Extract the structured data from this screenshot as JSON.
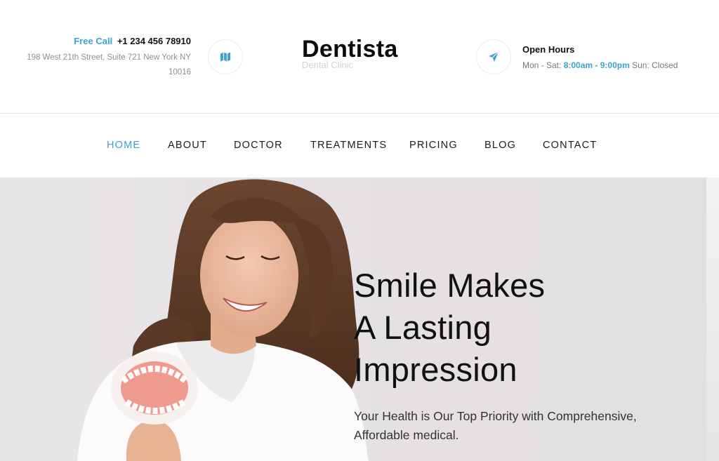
{
  "header": {
    "call_label": "Free Call",
    "phone": "+1 234 456 78910",
    "address_line1": "198 West 21th Street, Suite 721 New York NY",
    "address_line2": "10016",
    "logo_title": "Dentista",
    "logo_subtitle": "Dental Clinic",
    "hours_title": "Open Hours",
    "hours_prefix": "Mon - Sat:",
    "hours_time": "8:00am - 9:00pm",
    "hours_suffix": "Sun: Closed",
    "icons": [
      "map-icon",
      "paper-plane-icon"
    ]
  },
  "nav": {
    "items": [
      "HOME",
      "ABOUT",
      "DOCTOR",
      "TREATMENTS",
      "PRICING",
      "BLOG",
      "CONTACT"
    ],
    "active": "HOME"
  },
  "hero": {
    "title_line1": "Smile Makes",
    "title_line2": "A Lasting",
    "title_line3": "Impression",
    "subtitle_line1": "Your Health is Our Top Priority with Comprehensive,",
    "subtitle_line2": "Affordable medical."
  },
  "colors": {
    "accent": "#3aa4d0",
    "text_dark": "#111111",
    "text_muted": "#8f8f8f",
    "hero_bg": "#e5e1e5"
  }
}
